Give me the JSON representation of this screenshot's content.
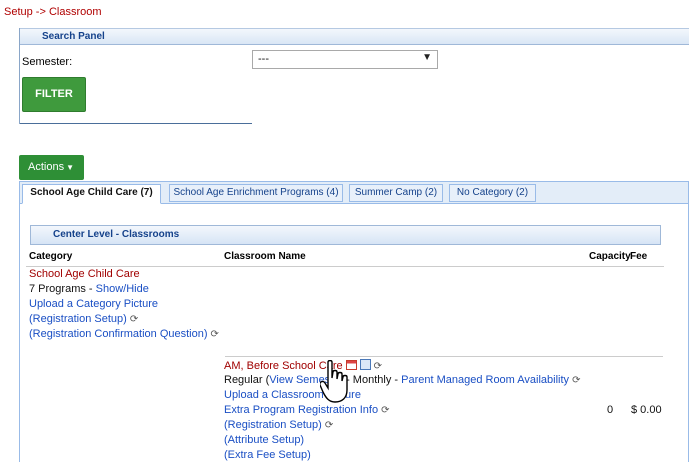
{
  "breadcrumb": "Setup -> Classroom",
  "search_panel": {
    "title": "Search Panel",
    "semester_label": "Semester:",
    "semester_value": "---",
    "filter_label": "FILTER"
  },
  "actions_label": "Actions",
  "tabs": [
    {
      "label": "School Age Child Care (7)",
      "active": true
    },
    {
      "label": "School Age Enrichment Programs (4)",
      "active": false
    },
    {
      "label": "Summer Camp (2)",
      "active": false
    },
    {
      "label": "No Category (2)",
      "active": false
    }
  ],
  "center_level_title": "Center Level - Classrooms",
  "columns": {
    "category": "Category",
    "classroom_name": "Classroom Name",
    "capacity": "Capacity",
    "fee": "Fee"
  },
  "category_block": {
    "name": "School Age Child Care",
    "programs_text": "7 Programs - ",
    "show_hide": "Show/Hide",
    "upload_picture": "Upload a Category Picture",
    "registration_setup": "(Registration Setup)",
    "confirmation_question": "(Registration Confirmation Question)"
  },
  "classroom": {
    "name": "AM, Before School Care",
    "regular_prefix": "Regular (",
    "view_semester": "View Semester",
    "monthly_text": " - Monthly - ",
    "parent_managed": "Parent Managed Room Availability",
    "upload_picture": "Upload a Classroom Picture",
    "extra_info": "Extra Program Registration Info",
    "capacity": "0",
    "fee": "$ 0.00",
    "registration_setup": "(Registration Setup)",
    "attribute_setup": "(Attribute Setup)",
    "extra_fee_setup": "(Extra Fee Setup)"
  },
  "colors": {
    "link": "#1a4fc4",
    "category_red": "#a00000",
    "button_green": "#3f9a3d",
    "panel_header": "#d9e6f5"
  }
}
